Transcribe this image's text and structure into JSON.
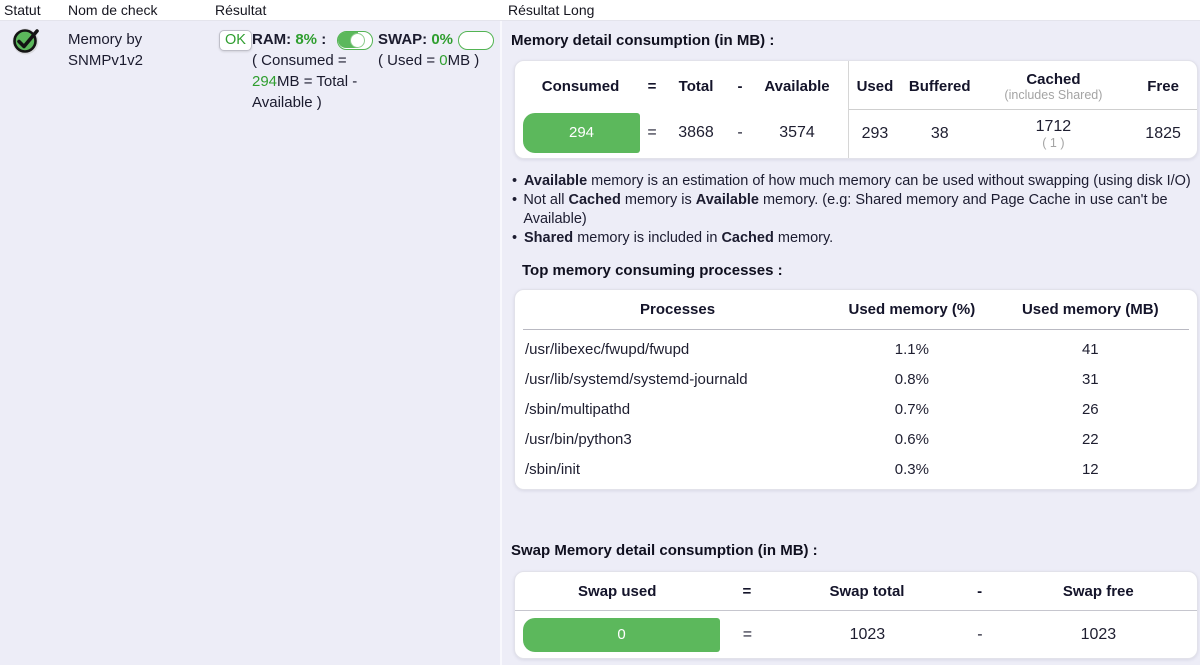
{
  "ui": {
    "bullet_char": "•"
  },
  "columns": {
    "statut": "Statut",
    "nom": "Nom de check",
    "resultat": "Résultat",
    "resultat_long": "Résultat Long"
  },
  "check": {
    "name_line1": "Memory by",
    "name_line2": "SNMPv1v2",
    "status_badge": "OK",
    "ram": {
      "label": "RAM:",
      "value": "8%",
      "suffix": ":",
      "note_pre": "( Consumed = ",
      "note_value": "294",
      "note_post": "MB = Total - Available )"
    },
    "swap": {
      "label": "SWAP:",
      "value": "0%",
      "suffix": ":",
      "note_pre": "( Used = ",
      "note_value": "0",
      "note_post": "MB )"
    }
  },
  "memory": {
    "title": "Memory detail consumption (in MB) :",
    "headers": {
      "consumed": "Consumed",
      "eq": "=",
      "total": "Total",
      "minus": "-",
      "available": "Available",
      "used": "Used",
      "buffered": "Buffered",
      "cached": "Cached",
      "cached_sub": "(includes Shared)",
      "free": "Free"
    },
    "values": {
      "consumed": "294",
      "eq": "=",
      "total": "3868",
      "minus": "-",
      "available": "3574",
      "used": "293",
      "buffered": "38",
      "cached": "1712",
      "cached_sub": "( 1 )",
      "free": "1825"
    },
    "bullets": {
      "b1": {
        "s1": "Available",
        "s2": " memory is an estimation of how much memory can be used without swapping (using disk I/O)"
      },
      "b2": {
        "s1": "Not all ",
        "s2": "Cached",
        "s3": " memory is ",
        "s4": "Available",
        "s5": " memory. (e.g: Shared memory and Page Cache in use can't be Available)"
      },
      "b3": {
        "s1": "Shared",
        "s2": " memory is included in ",
        "s3": "Cached",
        "s4": " memory."
      }
    }
  },
  "processes": {
    "title": "Top memory consuming processes :",
    "headers": [
      "Processes",
      "Used memory (%)",
      "Used memory (MB)"
    ],
    "rows": [
      [
        "/usr/libexec/fwupd/fwupd",
        "1.1%",
        "41"
      ],
      [
        "/usr/lib/systemd/systemd-journald",
        "0.8%",
        "31"
      ],
      [
        "/sbin/multipathd",
        "0.7%",
        "26"
      ],
      [
        "/usr/bin/python3",
        "0.6%",
        "22"
      ],
      [
        "/sbin/init",
        "0.3%",
        "12"
      ]
    ]
  },
  "swap_table": {
    "title": "Swap Memory detail consumption (in MB) :",
    "headers": [
      "Swap used",
      "=",
      "Swap total",
      "-",
      "Swap free"
    ],
    "values": [
      "0",
      "=",
      "1023",
      "-",
      "1023"
    ]
  },
  "colors": {
    "green_fill": "#5cb85c",
    "green_text": "#2f9e2f",
    "gray_sub": "#a4a4a4"
  }
}
